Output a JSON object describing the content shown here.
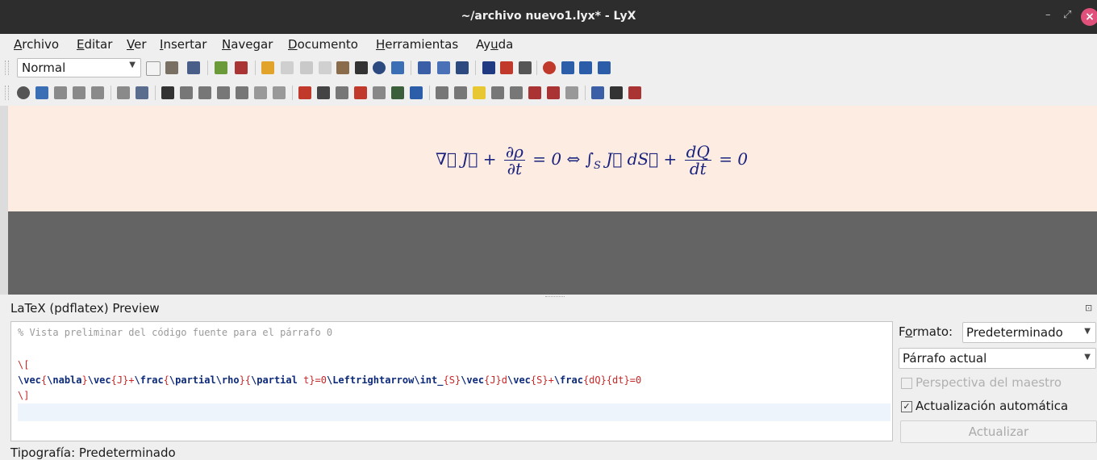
{
  "window": {
    "title": "~/archivo nuevo1.lyx* - LyX",
    "minimize": "–",
    "maximize": "⤢",
    "close": "×"
  },
  "menu": [
    {
      "pre": "",
      "u": "A",
      "post": "rchivo"
    },
    {
      "pre": "",
      "u": "E",
      "post": "ditar"
    },
    {
      "pre": "",
      "u": "V",
      "post": "er"
    },
    {
      "pre": "",
      "u": "I",
      "post": "nsertar"
    },
    {
      "pre": "",
      "u": "N",
      "post": "avegar"
    },
    {
      "pre": "",
      "u": "D",
      "post": "ocumento"
    },
    {
      "pre": "",
      "u": "H",
      "post": "erramientas"
    },
    {
      "pre": "Ay",
      "u": "u",
      "post": "da"
    }
  ],
  "toolbar": {
    "paragraph_style": "Normal"
  },
  "document": {
    "formula": {
      "part1": "∇⃗ J⃗ +",
      "frac1_num": "∂ρ",
      "frac1_den": "∂t",
      "part2": "= 0 ⇔ ∫",
      "sub": "S",
      "part3": "J⃗ dS⃗ +",
      "frac2_num": "dQ",
      "frac2_den": "dt",
      "part4": "= 0"
    }
  },
  "preview_panel": {
    "title": "LaTeX (pdflatex) Preview",
    "comment_line": "% Vista preliminar del código fuente para el párrafo 0",
    "open_bracket": "\\[",
    "close_bracket": "\\]",
    "formato_label_pre": "F",
    "formato_label_u": "o",
    "formato_label_post": "rmato:",
    "formato_value": "Predeterminado",
    "source_value": "Párrafo actual",
    "master_perspective": "Perspectiva del maestro",
    "auto_update": "Actualización automática",
    "update_button": "Actualizar"
  },
  "status": {
    "text": "Tipografía: Predeterminado"
  }
}
